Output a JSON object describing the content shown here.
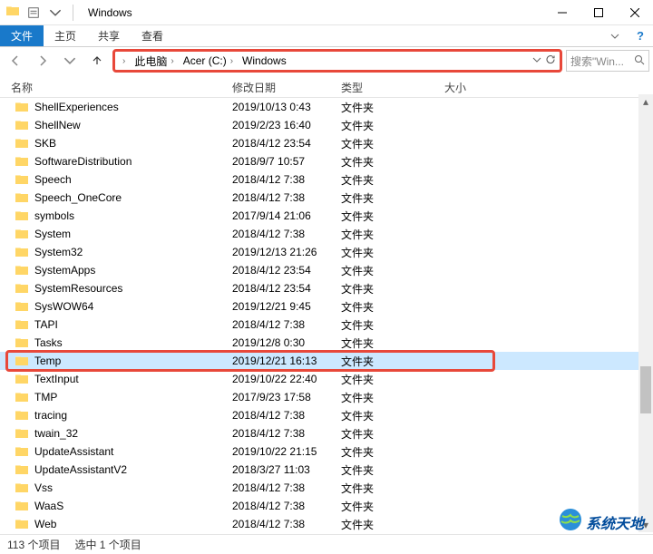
{
  "title": "Windows",
  "ribbon": {
    "file": "文件",
    "home": "主页",
    "share": "共享",
    "view": "查看",
    "help": "?"
  },
  "breadcrumb": {
    "seg1": "此电脑",
    "seg2": "Acer (C:)",
    "seg3": "Windows"
  },
  "search": {
    "placeholder": "搜索\"Win..."
  },
  "columns": {
    "name": "名称",
    "date": "修改日期",
    "type": "类型",
    "size": "大小"
  },
  "type_folder": "文件夹",
  "rows": [
    {
      "name": "ShellExperiences",
      "date": "2019/10/13 0:43"
    },
    {
      "name": "ShellNew",
      "date": "2019/2/23 16:40"
    },
    {
      "name": "SKB",
      "date": "2018/4/12 23:54"
    },
    {
      "name": "SoftwareDistribution",
      "date": "2018/9/7 10:57"
    },
    {
      "name": "Speech",
      "date": "2018/4/12 7:38"
    },
    {
      "name": "Speech_OneCore",
      "date": "2018/4/12 7:38"
    },
    {
      "name": "symbols",
      "date": "2017/9/14 21:06"
    },
    {
      "name": "System",
      "date": "2018/4/12 7:38"
    },
    {
      "name": "System32",
      "date": "2019/12/13 21:26"
    },
    {
      "name": "SystemApps",
      "date": "2018/4/12 23:54"
    },
    {
      "name": "SystemResources",
      "date": "2018/4/12 23:54"
    },
    {
      "name": "SysWOW64",
      "date": "2019/12/21 9:45"
    },
    {
      "name": "TAPI",
      "date": "2018/4/12 7:38"
    },
    {
      "name": "Tasks",
      "date": "2019/12/8 0:30"
    },
    {
      "name": "Temp",
      "date": "2019/12/21 16:13",
      "selected": true
    },
    {
      "name": "TextInput",
      "date": "2019/10/22 22:40"
    },
    {
      "name": "TMP",
      "date": "2017/9/23 17:58"
    },
    {
      "name": "tracing",
      "date": "2018/4/12 7:38"
    },
    {
      "name": "twain_32",
      "date": "2018/4/12 7:38"
    },
    {
      "name": "UpdateAssistant",
      "date": "2019/10/22 21:15"
    },
    {
      "name": "UpdateAssistantV2",
      "date": "2018/3/27 11:03"
    },
    {
      "name": "Vss",
      "date": "2018/4/12 7:38"
    },
    {
      "name": "WaaS",
      "date": "2018/4/12 7:38"
    },
    {
      "name": "Web",
      "date": "2018/4/12 7:38"
    }
  ],
  "status": {
    "count": "113 个项目",
    "selected": "选中 1 个项目"
  },
  "watermark": "系统天地"
}
